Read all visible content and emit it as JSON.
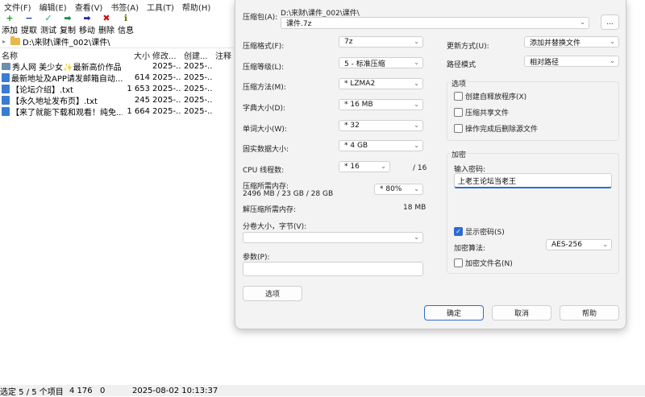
{
  "menu": [
    "文件(F)",
    "编辑(E)",
    "查看(V)",
    "书签(A)",
    "工具(T)",
    "帮助(H)"
  ],
  "toolbar": [
    {
      "label": "添加",
      "icon": "add-icon",
      "glyph": "+",
      "color": "#1a9a1a"
    },
    {
      "label": "提取",
      "icon": "extract-icon",
      "glyph": "−",
      "color": "#1f2fa0"
    },
    {
      "label": "测试",
      "icon": "test-icon",
      "glyph": "✓",
      "color": "#19a3a3"
    },
    {
      "label": "复制",
      "icon": "copy-icon",
      "glyph": "➡",
      "color": "#1a8a4a"
    },
    {
      "label": "移动",
      "icon": "move-icon",
      "glyph": "➡",
      "color": "#1f2fa0"
    },
    {
      "label": "删除",
      "icon": "delete-icon",
      "glyph": "✖",
      "color": "#cc1111"
    },
    {
      "label": "信息",
      "icon": "info-icon",
      "glyph": "ℹ",
      "color": "#6a6a00"
    }
  ],
  "address": "D:\\来财\\课件_002\\课件\\",
  "columns": {
    "name": "名称",
    "size": "大小",
    "modified": "修改...",
    "created": "创建...",
    "comment": "注释"
  },
  "files": [
    {
      "name": "秀人网 美少女✨最新高价作品",
      "size": "",
      "modified": "2025-...",
      "created": "2025-...",
      "type": "folder"
    },
    {
      "name": "最新地址及APP请发邮箱自动...",
      "size": "614",
      "modified": "2025-...",
      "created": "2025-...",
      "type": "file"
    },
    {
      "name": "【论坛介绍】.txt",
      "size": "1 653",
      "modified": "2025-...",
      "created": "2025-...",
      "type": "file"
    },
    {
      "name": "【永久地址发布页】.txt",
      "size": "245",
      "modified": "2025-...",
      "created": "2025-...",
      "type": "file"
    },
    {
      "name": "【来了就能下载和观看！纯免...",
      "size": "1 664",
      "modified": "2025-...",
      "created": "2025-...",
      "type": "file"
    }
  ],
  "status": {
    "selection": "选定 5 / 5 个项目",
    "size": "4 176",
    "packed": "0",
    "datetime": "2025-08-02 10:13:37"
  },
  "dialog": {
    "archive_label": "压缩包(A):",
    "archive_path": "D:\\来财\\课件_002\\课件\\",
    "archive_name": "课件.7z",
    "browse": "...",
    "format_label": "压缩格式(F):",
    "format_value": "7z",
    "level_label": "压缩等级(L):",
    "level_value": "5 - 标准压缩",
    "method_label": "压缩方法(M):",
    "method_value": "*  LZMA2",
    "dict_label": "字典大小(D):",
    "dict_value": "*  16 MB",
    "word_label": "单词大小(W):",
    "word_value": "*  32",
    "solid_label": "固实数据大小:",
    "solid_value": "*  4 GB",
    "cpu_label": "CPU 线程数:",
    "cpu_value": "*  16",
    "cpu_total": "/ 16",
    "mem_label": "压缩所需内存:",
    "mem_value": "2496 MB / 23 GB / 28 GB",
    "mem_percent": "* 80%",
    "decomp_label": "解压缩所需内存:",
    "decomp_value": "18 MB",
    "split_label": "分卷大小，字节(V):",
    "split_value": "",
    "params_label": "参数(P):",
    "params_value": "",
    "options_button": "选项",
    "update_label": "更新方式(U):",
    "update_value": "添加并替换文件",
    "pathmode_label": "路径模式",
    "pathmode_value": "相对路径",
    "options_group": "选项",
    "opt_sfx": "创建自释放程序(X)",
    "opt_shared": "压缩共享文件",
    "opt_delete": "操作完成后删除源文件",
    "enc_group": "加密",
    "password_label": "输入密码:",
    "password_value": "上老王论坛当老王",
    "show_password": "显示密码(S)",
    "enc_method_label": "加密算法:",
    "enc_method_value": "AES-256",
    "enc_names": "加密文件名(N)",
    "ok": "确定",
    "cancel": "取消",
    "help": "帮助"
  }
}
